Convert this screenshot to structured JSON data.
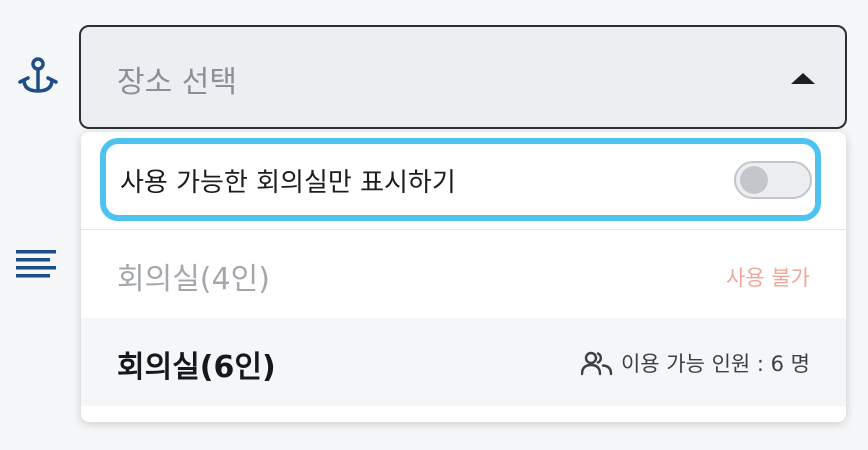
{
  "icons": {
    "location": "anchor-icon",
    "description": "lines-icon",
    "people": "people-icon",
    "caret": "caret-up-icon"
  },
  "colors": {
    "icon_blue": "#1d4e89",
    "focus_ring": "#4ec3f0",
    "unavailable_text": "#f0a79a"
  },
  "select": {
    "placeholder": "장소 선택",
    "expanded": true
  },
  "filter": {
    "label": "사용 가능한 회의실만 표시하기",
    "enabled": false
  },
  "rooms": [
    {
      "name": "회의실(4인)",
      "status": "사용 불가",
      "available": false
    },
    {
      "name": "회의실(6인)",
      "capacity_text": "이용 가능 인원 : 6 명",
      "available": true
    }
  ]
}
